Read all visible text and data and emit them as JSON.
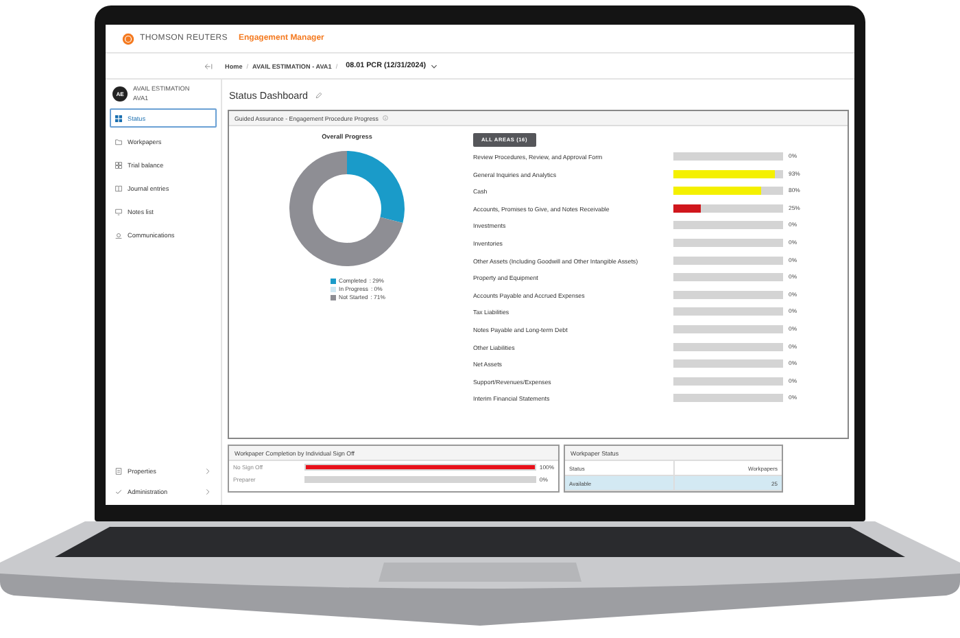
{
  "header": {
    "brand": "THOMSON REUTERS",
    "product": "Engagement Manager"
  },
  "breadcrumb": {
    "separator": "/",
    "items": [
      "Home",
      "AVAIL ESTIMATION - AVA1",
      "08.01 PCR (12/31/2024)"
    ]
  },
  "sidebar": {
    "avatar": "AE",
    "client_name": "AVAIL ESTIMATION",
    "client_code": "AVA1",
    "items": [
      {
        "label": "Status",
        "selected": true
      },
      {
        "label": "Workpapers",
        "selected": false
      },
      {
        "label": "Trial balance",
        "selected": false
      },
      {
        "label": "Journal entries",
        "selected": false
      },
      {
        "label": "Notes list",
        "selected": false
      },
      {
        "label": "Communications",
        "selected": false
      }
    ],
    "footer_items": [
      {
        "label": "Properties"
      },
      {
        "label": "Administration"
      }
    ]
  },
  "page_title": "Status Dashboard",
  "progress_panel": {
    "title": "Guided Assurance - Engagement Procedure Progress",
    "chart_data": {
      "type": "donut",
      "categories": [
        "Completed",
        "In Progress",
        "Not Started"
      ],
      "series": [
        {
          "name": "Overall Progress",
          "values": [
            29,
            0,
            71
          ]
        }
      ]
    },
    "legend": [
      {
        "color": "#1a9bc9",
        "value_text": ": 29%"
      },
      {
        "color": "#cfe8f3",
        "value_text": ": 0%"
      },
      {
        "color": "#8e8e94",
        "value_text": ": 71%"
      }
    ],
    "filter_button": "ALL AREAS (16)",
    "areas": [
      {
        "name": "Review Procedures, Review, and Approval Form",
        "level": 0,
        "reading": "0%"
      },
      {
        "name": "General Inquiries and Analytics",
        "level": 0.93,
        "reading": "93%"
      },
      {
        "name": "Cash",
        "level": 0.8,
        "reading": "80%"
      },
      {
        "name": "Accounts, Promises to Give, and Notes Receivable",
        "level": 0.25,
        "reading": "25%"
      },
      {
        "name": "Investments",
        "level": 0,
        "reading": "0%"
      },
      {
        "name": "Inventories",
        "level": 0,
        "reading": "0%"
      },
      {
        "name": "Other Assets (Including Goodwill and Other Intangible Assets)",
        "level": 0,
        "reading": "0%"
      },
      {
        "name": "Property and Equipment",
        "level": 0,
        "reading": "0%"
      },
      {
        "name": "Accounts Payable and Accrued Expenses",
        "level": 0,
        "reading": "0%"
      },
      {
        "name": "Tax Liabilities",
        "level": 0,
        "reading": "0%"
      },
      {
        "name": "Notes Payable and Long-term Debt",
        "level": 0,
        "reading": "0%"
      },
      {
        "name": "Other Liabilities",
        "level": 0,
        "reading": "0%"
      },
      {
        "name": "Net Assets",
        "level": 0,
        "reading": "0%"
      },
      {
        "name": "Support/Revenues/Expenses",
        "level": 0,
        "reading": "0%"
      },
      {
        "name": "Interim Financial Statements",
        "level": 0,
        "reading": "0%"
      }
    ]
  },
  "signoff_panel": {
    "title": "Workpaper Completion by Individual Sign Off",
    "rows": [
      {
        "name": "No Sign Off",
        "level": 1,
        "reading": "100%"
      },
      {
        "name": "Preparer",
        "level": 0,
        "reading": "0%"
      }
    ]
  },
  "status_panel": {
    "title": "Workpaper Status",
    "columns": [
      "Status",
      "Workpapers"
    ],
    "rows": [
      {
        "status": "Available",
        "count": "25",
        "selected": true
      }
    ]
  }
}
